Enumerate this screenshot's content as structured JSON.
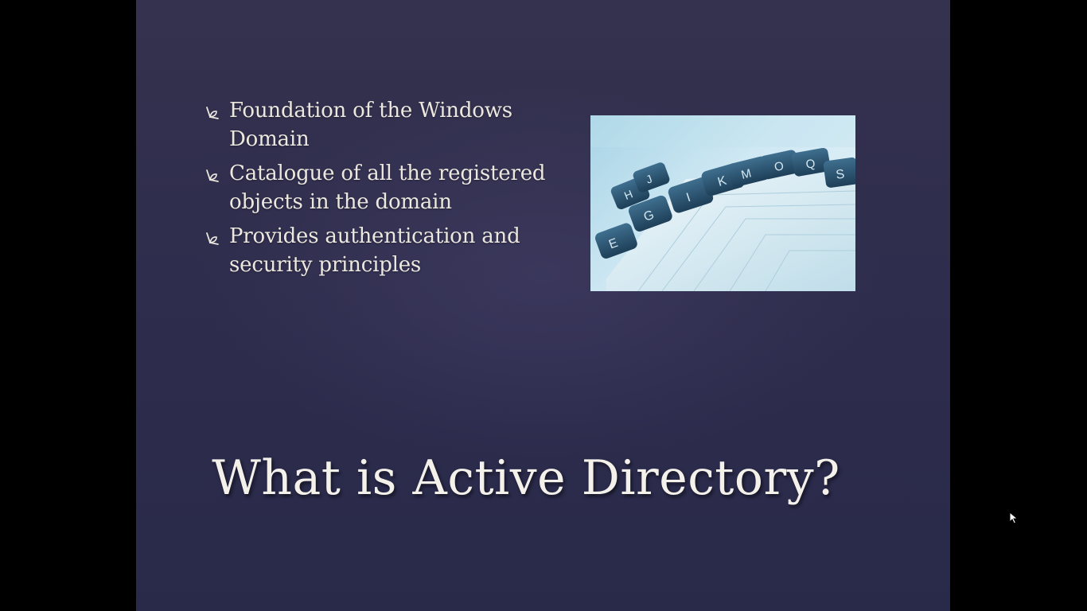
{
  "slide": {
    "bullets": [
      {
        "text": "Foundation of the Windows Domain",
        "icon": "leaf-bullet-icon"
      },
      {
        "text": "Catalogue of all the registered objects in the domain",
        "icon": "leaf-bullet-icon"
      },
      {
        "text": "Provides authentication and security principles",
        "icon": "leaf-bullet-icon"
      }
    ],
    "image": {
      "tab_letters": [
        "E",
        "G",
        "H",
        "I",
        "J",
        "K",
        "M",
        "O",
        "Q",
        "S"
      ],
      "description_icon": "file-index-tabs-photo"
    },
    "title": "What is Active Directory?"
  },
  "colors": {
    "slide_background": "#302e4d",
    "text": "#ece8df",
    "letterbox": "#000000"
  }
}
